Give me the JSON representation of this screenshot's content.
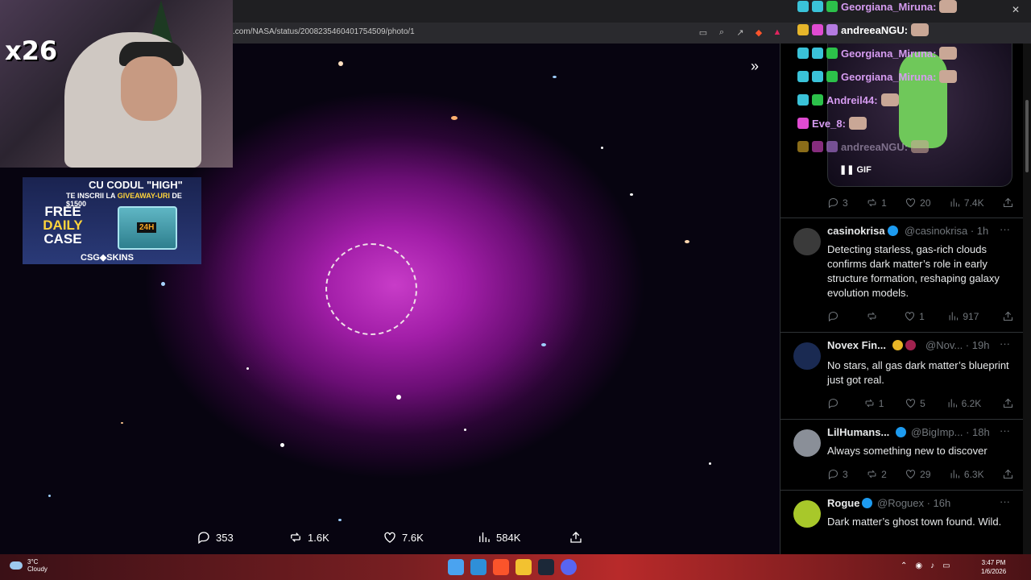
{
  "browser": {
    "url": ".com/NASA/status/2008235460401754509/photo/1",
    "close_label": "✕"
  },
  "stream": {
    "multiplier": "x26"
  },
  "promo": {
    "line1": "CU CODUL \"HIGH\"",
    "line2_pre": "TE INSCRII LA",
    "line2_mid": "GIVEAWAY-URI",
    "line2_post": "DE $1500",
    "free1": "FREE",
    "free2": "DAILY",
    "free3": "CASE",
    "box_label": "24H",
    "brand": "CSG◆SKINS"
  },
  "photo_actions": {
    "replies": "353",
    "reposts": "1.6K",
    "likes": "7.6K",
    "views": "584K"
  },
  "gif": {
    "label": "GIF",
    "metrics": {
      "replies": "3",
      "reposts": "1",
      "likes": "20",
      "views": "7.4K"
    }
  },
  "posts": [
    {
      "name": "casinokrisa",
      "handle": "@casinokrisa · 1h",
      "text": "Detecting starless, gas-rich clouds confirms dark matter’s role in early structure formation, reshaping galaxy evolution models.",
      "replies": "",
      "reposts": "",
      "likes": "1",
      "views": "917"
    },
    {
      "name": "Novex Fin...",
      "handle": "@Nov... · 19h",
      "text": "No stars, all gas dark matter’s blueprint just got real.",
      "replies": "",
      "reposts": "1",
      "likes": "5",
      "views": "6.2K"
    },
    {
      "name": "LilHumans...",
      "handle": "@BigImp... · 18h",
      "text": "Always something new to discover",
      "replies": "3",
      "reposts": "2",
      "likes": "29",
      "views": "6.3K"
    },
    {
      "name": "Rogue",
      "handle": "@Roguex · 16h",
      "text": "Dark matter’s ghost town found. Wild.",
      "replies": "",
      "reposts": "",
      "likes": "",
      "views": ""
    }
  ],
  "chat": [
    {
      "user": "Georgiana_Miruna:",
      "color": "#d59bf0"
    },
    {
      "user": "andreeaNGU:",
      "color": "#ffffff"
    },
    {
      "user": "Georgiana_Miruna:",
      "color": "#d59bf0"
    },
    {
      "user": "Georgiana_Miruna:",
      "color": "#d59bf0"
    },
    {
      "user": "Andreil44:",
      "color": "#d59bf0"
    },
    {
      "user": "Eve_8:",
      "color": "#d59bf0"
    },
    {
      "user": "andreeaNGU:",
      "color": "#b9a8c8"
    }
  ],
  "taskbar": {
    "temp": "3°C",
    "weather": "Cloudy",
    "time": "3:47 PM",
    "date": "1/6/2026"
  }
}
